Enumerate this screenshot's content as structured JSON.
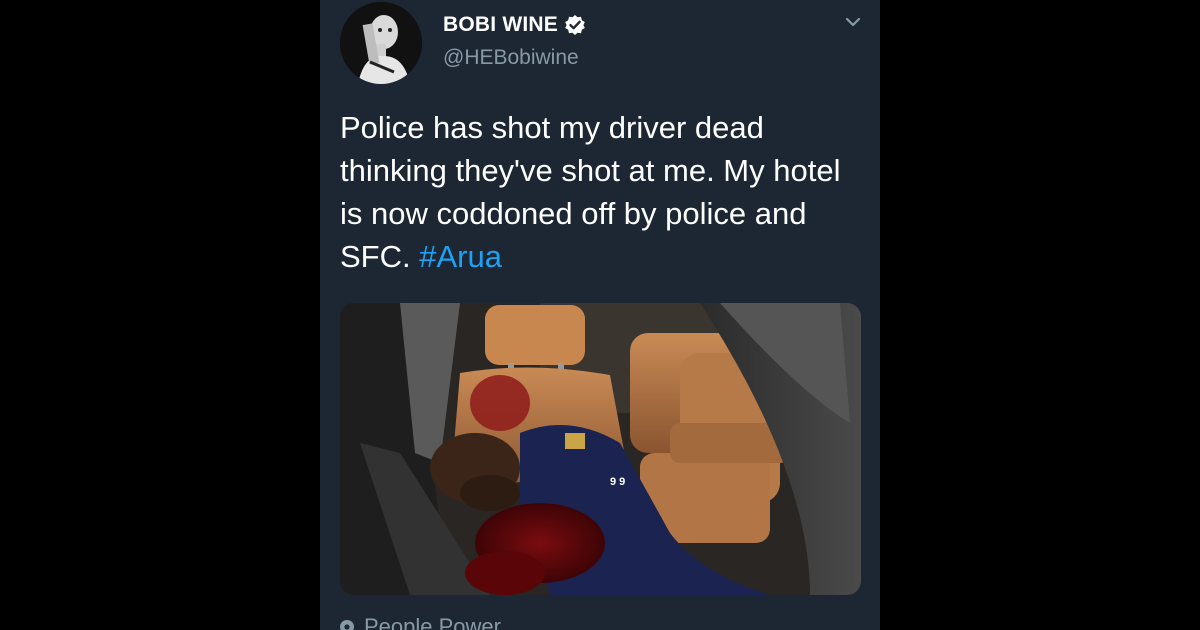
{
  "tweet": {
    "author": {
      "display_name": "BOBI WINE",
      "handle": "@HEBobiwine",
      "verified": true,
      "avatar_icon": "profile-avatar"
    },
    "menu_icon": "chevron-down-icon",
    "text_main": "Police has shot my driver dead thinking they've shot at me. My hotel is now coddoned off by police and SFC.",
    "hashtag": "#Arua",
    "media_icon": "photo-attachment",
    "location": "People Power"
  },
  "colors": {
    "page_background": "#000000",
    "card_background": "#1c2733",
    "text_primary": "#ffffff",
    "text_secondary": "#8899a6",
    "link": "#1da1f2",
    "verified_badge": "#ffffff"
  }
}
